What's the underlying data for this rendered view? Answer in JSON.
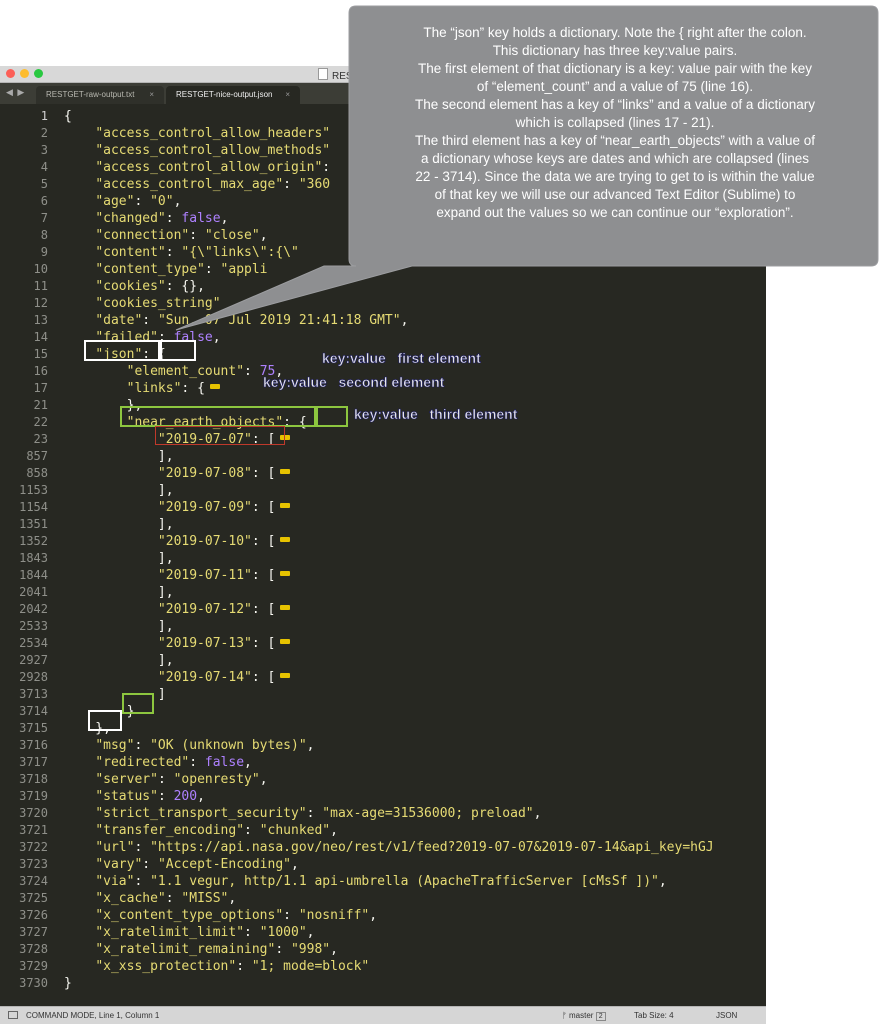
{
  "window": {
    "title": "REST",
    "tabs": [
      {
        "label": "RESTGET-raw-output.txt",
        "close": "×",
        "active": false
      },
      {
        "label": "RESTGET-nice-output.json",
        "close": "×",
        "active": true
      }
    ],
    "tab_nav_glyph": "◀ ▶"
  },
  "editor": {
    "lines": [
      {
        "num": "1",
        "segments": [
          {
            "t": "p",
            "v": "{"
          }
        ]
      },
      {
        "num": "2",
        "segments": [
          {
            "t": "p",
            "v": "    "
          },
          {
            "t": "k",
            "v": "\"access_control_allow_headers\""
          }
        ]
      },
      {
        "num": "3",
        "segments": [
          {
            "t": "p",
            "v": "    "
          },
          {
            "t": "k",
            "v": "\"access_control_allow_methods\""
          }
        ]
      },
      {
        "num": "4",
        "segments": [
          {
            "t": "p",
            "v": "    "
          },
          {
            "t": "k",
            "v": "\"access_control_allow_origin\""
          },
          {
            "t": "p",
            "v": ":"
          }
        ]
      },
      {
        "num": "5",
        "segments": [
          {
            "t": "p",
            "v": "    "
          },
          {
            "t": "k",
            "v": "\"access_control_max_age\""
          },
          {
            "t": "p",
            "v": ": "
          },
          {
            "t": "k",
            "v": "\"360"
          }
        ]
      },
      {
        "num": "6",
        "segments": [
          {
            "t": "p",
            "v": "    "
          },
          {
            "t": "k",
            "v": "\"age\""
          },
          {
            "t": "p",
            "v": ": "
          },
          {
            "t": "k",
            "v": "\"0\""
          },
          {
            "t": "p",
            "v": ","
          }
        ]
      },
      {
        "num": "7",
        "segments": [
          {
            "t": "p",
            "v": "    "
          },
          {
            "t": "k",
            "v": "\"changed\""
          },
          {
            "t": "p",
            "v": ": "
          },
          {
            "t": "n",
            "v": "false"
          },
          {
            "t": "p",
            "v": ","
          }
        ]
      },
      {
        "num": "8",
        "segments": [
          {
            "t": "p",
            "v": "    "
          },
          {
            "t": "k",
            "v": "\"connection\""
          },
          {
            "t": "p",
            "v": ": "
          },
          {
            "t": "k",
            "v": "\"close\""
          },
          {
            "t": "p",
            "v": ","
          }
        ]
      },
      {
        "num": "9",
        "segments": [
          {
            "t": "p",
            "v": "    "
          },
          {
            "t": "k",
            "v": "\"content\""
          },
          {
            "t": "p",
            "v": ": "
          },
          {
            "t": "k",
            "v": "\"{\\\"links\\\":{\\\""
          }
        ]
      },
      {
        "num": "10",
        "segments": [
          {
            "t": "p",
            "v": "    "
          },
          {
            "t": "k",
            "v": "\"content_type\""
          },
          {
            "t": "p",
            "v": ": "
          },
          {
            "t": "k",
            "v": "\"appli"
          }
        ]
      },
      {
        "num": "11",
        "segments": [
          {
            "t": "p",
            "v": "    "
          },
          {
            "t": "k",
            "v": "\"cookies\""
          },
          {
            "t": "p",
            "v": ": {},"
          }
        ]
      },
      {
        "num": "12",
        "segments": [
          {
            "t": "p",
            "v": "    "
          },
          {
            "t": "k",
            "v": "\"cookies_string\""
          }
        ]
      },
      {
        "num": "13",
        "segments": [
          {
            "t": "p",
            "v": "    "
          },
          {
            "t": "k",
            "v": "\"date\""
          },
          {
            "t": "p",
            "v": ": "
          },
          {
            "t": "k",
            "v": "\"Sun, 07 Jul 2019 21:41:18 GMT\""
          },
          {
            "t": "p",
            "v": ","
          }
        ]
      },
      {
        "num": "14",
        "segments": [
          {
            "t": "p",
            "v": "    "
          },
          {
            "t": "k",
            "v": "\"failed\""
          },
          {
            "t": "p",
            "v": ": "
          },
          {
            "t": "n",
            "v": "false"
          },
          {
            "t": "p",
            "v": ","
          }
        ]
      },
      {
        "num": "15",
        "segments": [
          {
            "t": "p",
            "v": "    "
          },
          {
            "t": "k",
            "v": "\"json\""
          },
          {
            "t": "p",
            "v": ": {"
          }
        ]
      },
      {
        "num": "16",
        "segments": [
          {
            "t": "p",
            "v": "        "
          },
          {
            "t": "k",
            "v": "\"element_count\""
          },
          {
            "t": "p",
            "v": ": "
          },
          {
            "t": "n",
            "v": "75"
          },
          {
            "t": "p",
            "v": ","
          }
        ]
      },
      {
        "num": "17",
        "segments": [
          {
            "t": "p",
            "v": "        "
          },
          {
            "t": "k",
            "v": "\"links\""
          },
          {
            "t": "p",
            "v": ": {"
          }
        ],
        "fold": true
      },
      {
        "num": "21",
        "segments": [
          {
            "t": "p",
            "v": "        },"
          }
        ]
      },
      {
        "num": "22",
        "segments": [
          {
            "t": "p",
            "v": "        "
          },
          {
            "t": "k",
            "v": "\"near_earth_objects\""
          },
          {
            "t": "p",
            "v": ": {"
          }
        ]
      },
      {
        "num": "23",
        "segments": [
          {
            "t": "p",
            "v": "            "
          },
          {
            "t": "k",
            "v": "\"2019-07-07\""
          },
          {
            "t": "p",
            "v": ": ["
          }
        ],
        "fold": true
      },
      {
        "num": "857",
        "segments": [
          {
            "t": "p",
            "v": "            ],"
          }
        ]
      },
      {
        "num": "858",
        "segments": [
          {
            "t": "p",
            "v": "            "
          },
          {
            "t": "k",
            "v": "\"2019-07-08\""
          },
          {
            "t": "p",
            "v": ": ["
          }
        ],
        "fold": true
      },
      {
        "num": "1153",
        "segments": [
          {
            "t": "p",
            "v": "            ],"
          }
        ]
      },
      {
        "num": "1154",
        "segments": [
          {
            "t": "p",
            "v": "            "
          },
          {
            "t": "k",
            "v": "\"2019-07-09\""
          },
          {
            "t": "p",
            "v": ": ["
          }
        ],
        "fold": true
      },
      {
        "num": "1351",
        "segments": [
          {
            "t": "p",
            "v": "            ],"
          }
        ]
      },
      {
        "num": "1352",
        "segments": [
          {
            "t": "p",
            "v": "            "
          },
          {
            "t": "k",
            "v": "\"2019-07-10\""
          },
          {
            "t": "p",
            "v": ": ["
          }
        ],
        "fold": true
      },
      {
        "num": "1843",
        "segments": [
          {
            "t": "p",
            "v": "            ],"
          }
        ]
      },
      {
        "num": "1844",
        "segments": [
          {
            "t": "p",
            "v": "            "
          },
          {
            "t": "k",
            "v": "\"2019-07-11\""
          },
          {
            "t": "p",
            "v": ": ["
          }
        ],
        "fold": true
      },
      {
        "num": "2041",
        "segments": [
          {
            "t": "p",
            "v": "            ],"
          }
        ]
      },
      {
        "num": "2042",
        "segments": [
          {
            "t": "p",
            "v": "            "
          },
          {
            "t": "k",
            "v": "\"2019-07-12\""
          },
          {
            "t": "p",
            "v": ": ["
          }
        ],
        "fold": true
      },
      {
        "num": "2533",
        "segments": [
          {
            "t": "p",
            "v": "            ],"
          }
        ]
      },
      {
        "num": "2534",
        "segments": [
          {
            "t": "p",
            "v": "            "
          },
          {
            "t": "k",
            "v": "\"2019-07-13\""
          },
          {
            "t": "p",
            "v": ": ["
          }
        ],
        "fold": true
      },
      {
        "num": "2927",
        "segments": [
          {
            "t": "p",
            "v": "            ],"
          }
        ]
      },
      {
        "num": "2928",
        "segments": [
          {
            "t": "p",
            "v": "            "
          },
          {
            "t": "k",
            "v": "\"2019-07-14\""
          },
          {
            "t": "p",
            "v": ": ["
          }
        ],
        "fold": true
      },
      {
        "num": "3713",
        "segments": [
          {
            "t": "p",
            "v": "            ]"
          }
        ]
      },
      {
        "num": "3714",
        "segments": [
          {
            "t": "p",
            "v": "        }"
          }
        ]
      },
      {
        "num": "3715",
        "segments": [
          {
            "t": "p",
            "v": "    },"
          }
        ]
      },
      {
        "num": "3716",
        "segments": [
          {
            "t": "p",
            "v": "    "
          },
          {
            "t": "k",
            "v": "\"msg\""
          },
          {
            "t": "p",
            "v": ": "
          },
          {
            "t": "k",
            "v": "\"OK (unknown bytes)\""
          },
          {
            "t": "p",
            "v": ","
          }
        ]
      },
      {
        "num": "3717",
        "segments": [
          {
            "t": "p",
            "v": "    "
          },
          {
            "t": "k",
            "v": "\"redirected\""
          },
          {
            "t": "p",
            "v": ": "
          },
          {
            "t": "n",
            "v": "false"
          },
          {
            "t": "p",
            "v": ","
          }
        ]
      },
      {
        "num": "3718",
        "segments": [
          {
            "t": "p",
            "v": "    "
          },
          {
            "t": "k",
            "v": "\"server\""
          },
          {
            "t": "p",
            "v": ": "
          },
          {
            "t": "k",
            "v": "\"openresty\""
          },
          {
            "t": "p",
            "v": ","
          }
        ]
      },
      {
        "num": "3719",
        "segments": [
          {
            "t": "p",
            "v": "    "
          },
          {
            "t": "k",
            "v": "\"status\""
          },
          {
            "t": "p",
            "v": ": "
          },
          {
            "t": "n",
            "v": "200"
          },
          {
            "t": "p",
            "v": ","
          }
        ]
      },
      {
        "num": "3720",
        "segments": [
          {
            "t": "p",
            "v": "    "
          },
          {
            "t": "k",
            "v": "\"strict_transport_security\""
          },
          {
            "t": "p",
            "v": ": "
          },
          {
            "t": "k",
            "v": "\"max-age=31536000; preload\""
          },
          {
            "t": "p",
            "v": ","
          }
        ]
      },
      {
        "num": "3721",
        "segments": [
          {
            "t": "p",
            "v": "    "
          },
          {
            "t": "k",
            "v": "\"transfer_encoding\""
          },
          {
            "t": "p",
            "v": ": "
          },
          {
            "t": "k",
            "v": "\"chunked\""
          },
          {
            "t": "p",
            "v": ","
          }
        ]
      },
      {
        "num": "3722",
        "segments": [
          {
            "t": "p",
            "v": "    "
          },
          {
            "t": "k",
            "v": "\"url\""
          },
          {
            "t": "p",
            "v": ": "
          },
          {
            "t": "k",
            "v": "\"https://api.nasa.gov/neo/rest/v1/feed?2019-07-07&2019-07-14&api_key=hGJ"
          }
        ]
      },
      {
        "num": "3723",
        "segments": [
          {
            "t": "p",
            "v": "    "
          },
          {
            "t": "k",
            "v": "\"vary\""
          },
          {
            "t": "p",
            "v": ": "
          },
          {
            "t": "k",
            "v": "\"Accept-Encoding\""
          },
          {
            "t": "p",
            "v": ","
          }
        ]
      },
      {
        "num": "3724",
        "segments": [
          {
            "t": "p",
            "v": "    "
          },
          {
            "t": "k",
            "v": "\"via\""
          },
          {
            "t": "p",
            "v": ": "
          },
          {
            "t": "k",
            "v": "\"1.1 vegur, http/1.1 api-umbrella (ApacheTrafficServer [cMsSf ])\""
          },
          {
            "t": "p",
            "v": ","
          }
        ]
      },
      {
        "num": "3725",
        "segments": [
          {
            "t": "p",
            "v": "    "
          },
          {
            "t": "k",
            "v": "\"x_cache\""
          },
          {
            "t": "p",
            "v": ": "
          },
          {
            "t": "k",
            "v": "\"MISS\""
          },
          {
            "t": "p",
            "v": ","
          }
        ]
      },
      {
        "num": "3726",
        "segments": [
          {
            "t": "p",
            "v": "    "
          },
          {
            "t": "k",
            "v": "\"x_content_type_options\""
          },
          {
            "t": "p",
            "v": ": "
          },
          {
            "t": "k",
            "v": "\"nosniff\""
          },
          {
            "t": "p",
            "v": ","
          }
        ]
      },
      {
        "num": "3727",
        "segments": [
          {
            "t": "p",
            "v": "    "
          },
          {
            "t": "k",
            "v": "\"x_ratelimit_limit\""
          },
          {
            "t": "p",
            "v": ": "
          },
          {
            "t": "k",
            "v": "\"1000\""
          },
          {
            "t": "p",
            "v": ","
          }
        ]
      },
      {
        "num": "3728",
        "segments": [
          {
            "t": "p",
            "v": "    "
          },
          {
            "t": "k",
            "v": "\"x_ratelimit_remaining\""
          },
          {
            "t": "p",
            "v": ": "
          },
          {
            "t": "k",
            "v": "\"998\""
          },
          {
            "t": "p",
            "v": ","
          }
        ]
      },
      {
        "num": "3729",
        "segments": [
          {
            "t": "p",
            "v": "    "
          },
          {
            "t": "k",
            "v": "\"x_xss_protection\""
          },
          {
            "t": "p",
            "v": ": "
          },
          {
            "t": "k",
            "v": "\"1; mode=block\""
          }
        ]
      },
      {
        "num": "3730",
        "segments": [
          {
            "t": "p",
            "v": "}"
          }
        ]
      }
    ]
  },
  "annotations": {
    "first": "key:value   first element",
    "second": "key:value   second element",
    "third": "key:value   third element"
  },
  "callout": {
    "lines": [
      "The “json” key holds a dictionary. Note the { right after the colon.",
      "This dictionary has three key:value pairs.",
      "The first element of that dictionary is a key: value pair with the key",
      "of “element_count” and a value of 75 (line 16).",
      "The second element has a key of “links” and a value of a dictionary",
      "which is collapsed (lines 17 - 21).",
      "The third element has a key of “near_earth_objects” with a value of",
      "a dictionary whose keys are dates and which are collapsed (lines",
      "22 - 3714).  Since the data we are trying to get to is within the value",
      "of that key we will use our advanced Text Editor (Sublime) to",
      "expand out the values so we can continue our “exploration”."
    ],
    "fill": "#8e8f91"
  },
  "statusbar": {
    "mode": "COMMAND MODE, Line 1, Column 1",
    "branch": "ᚠ master",
    "branch_count": "2",
    "tab_size": "Tab Size: 4",
    "syntax": "JSON"
  },
  "colors": {
    "editor_bg": "#272822",
    "string": "#e6db74",
    "number": "#ae81ff",
    "highlight_white": "#ffffff",
    "highlight_green": "#8dc63f"
  }
}
